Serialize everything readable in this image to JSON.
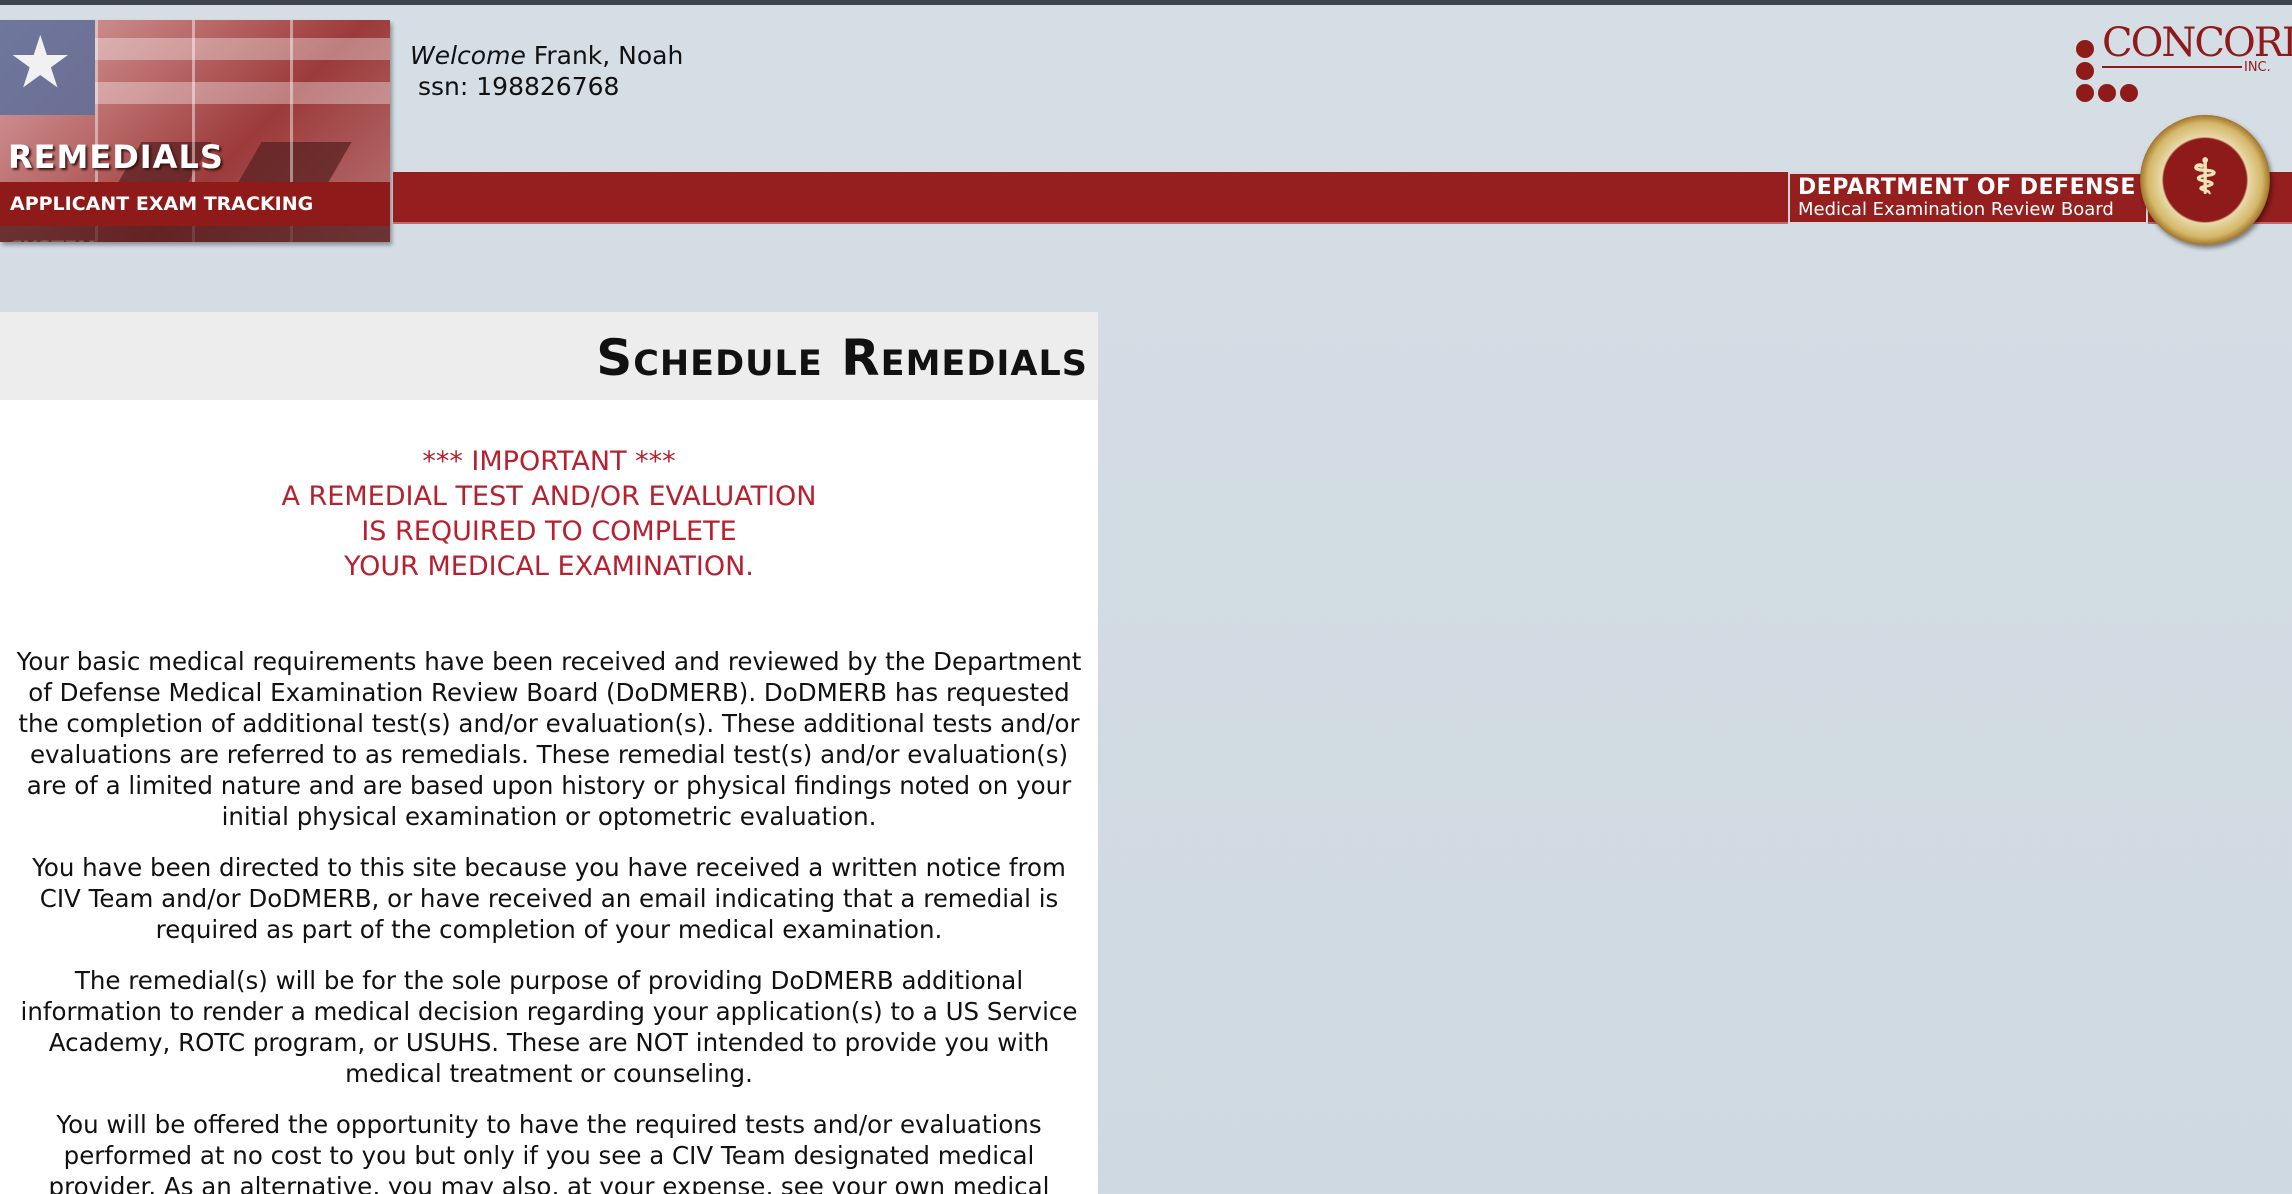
{
  "header": {
    "banner_title": "REMEDIALS",
    "banner_subtitle": "APPLICANT EXAM TRACKING SYSTEM",
    "welcome_prefix": "Welcome",
    "user_name": "Frank, Noah",
    "ssn_label": "ssn:",
    "ssn_value": "198826768",
    "company_logo": "CONCORDE",
    "company_suffix": "INC.",
    "dept_line1": "DEPARTMENT OF DEFENSE",
    "dept_line2": "Medical Examination Review Board"
  },
  "page": {
    "title": "Schedule Remedials",
    "important": [
      "*** IMPORTANT ***",
      "A REMEDIAL TEST AND/OR EVALUATION",
      "IS REQUIRED TO COMPLETE",
      "YOUR MEDICAL EXAMINATION."
    ],
    "paragraphs": [
      "Your basic medical requirements have been received and reviewed by the Department of Defense Medical Examination Review Board (DoDMERB). DoDMERB has requested the completion of additional test(s) and/or evaluation(s). These additional tests and/or evaluations are referred to as remedials. These remedial test(s) and/or evaluation(s) are of a limited nature and are based upon history or physical findings noted on your initial physical examination or optometric evaluation.",
      "You have been directed to this site because you have received a written notice from CIV Team and/or DoDMERB, or have received an email indicating that a remedial is required as part of the completion of your medical examination.",
      "The remedial(s) will be for the sole purpose of providing DoDMERB additional information to render a medical decision regarding your application(s) to a US Service Academy, ROTC program, or USUHS. These are NOT intended to provide you with medical treatment or counseling.",
      "You will be offered the opportunity to have the required tests and/or evaluations performed at no cost to you but only if you see a CIV Team designated medical provider. As an alternative, you may also, at your expense, see your own medical provider. In that"
    ]
  },
  "colors": {
    "header_red": "#951f1f",
    "important_red": "#b7202e",
    "background": "#d5dee5"
  }
}
